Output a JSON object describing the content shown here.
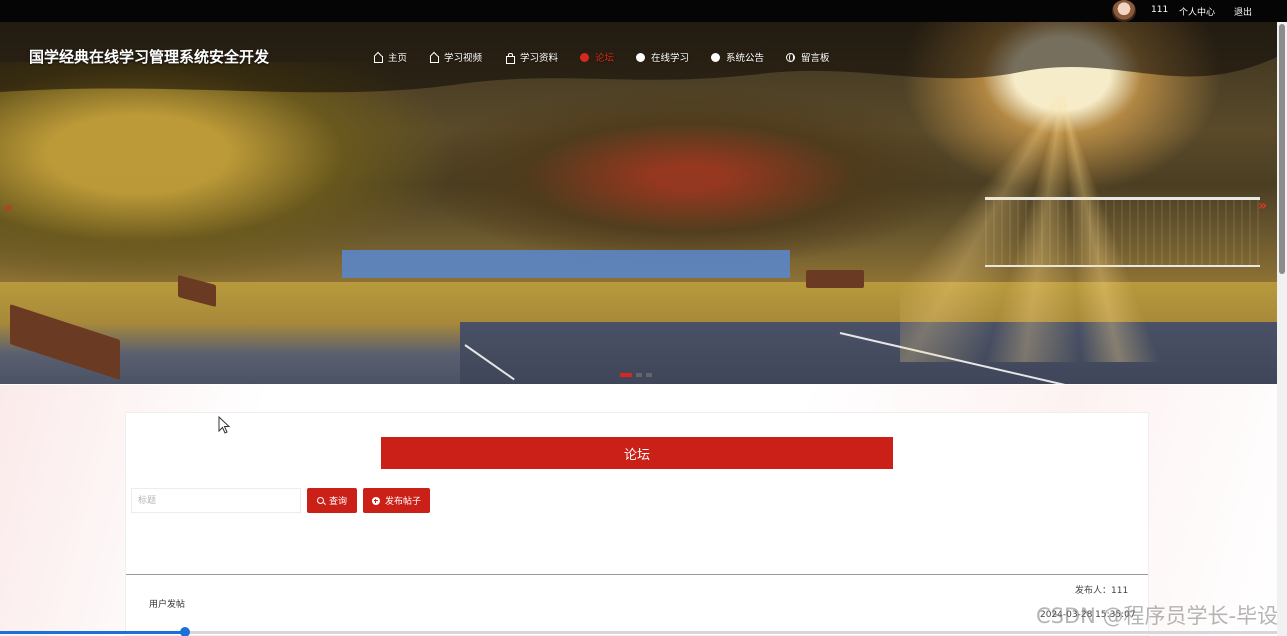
{
  "topbar": {
    "username": "111",
    "profile_label": "个人中心",
    "logout_label": "退出"
  },
  "brand": {
    "title": "国学经典在线学习管理系统安全开发"
  },
  "nav": {
    "items": [
      {
        "label": "主页",
        "icon": "home-icon"
      },
      {
        "label": "学习视频",
        "icon": "home-icon"
      },
      {
        "label": "学习资料",
        "icon": "bag-icon"
      },
      {
        "label": "论坛",
        "icon": "dot-icon",
        "active": true
      },
      {
        "label": "在线学习",
        "icon": "dot-icon"
      },
      {
        "label": "系统公告",
        "icon": "dot-icon"
      },
      {
        "label": "留言板",
        "icon": "globe-icon"
      }
    ]
  },
  "carousel": {
    "prev": "«",
    "next": "»",
    "slide_count": 3,
    "active_index": 0
  },
  "forum": {
    "heading": "论坛",
    "search_placeholder": "标题",
    "search_button": "查询",
    "post_button": "发布帖子",
    "posts": [
      {
        "title": "用户发帖",
        "author_label": "发布人：111",
        "time": "2024-03-28 15:35:07"
      }
    ]
  },
  "watermark": "CSDN @程序员学长-毕设",
  "video_progress": 0.145,
  "colors": {
    "accent": "#cb2017",
    "active_nav": "#d7281e",
    "topbar": "#050505"
  }
}
